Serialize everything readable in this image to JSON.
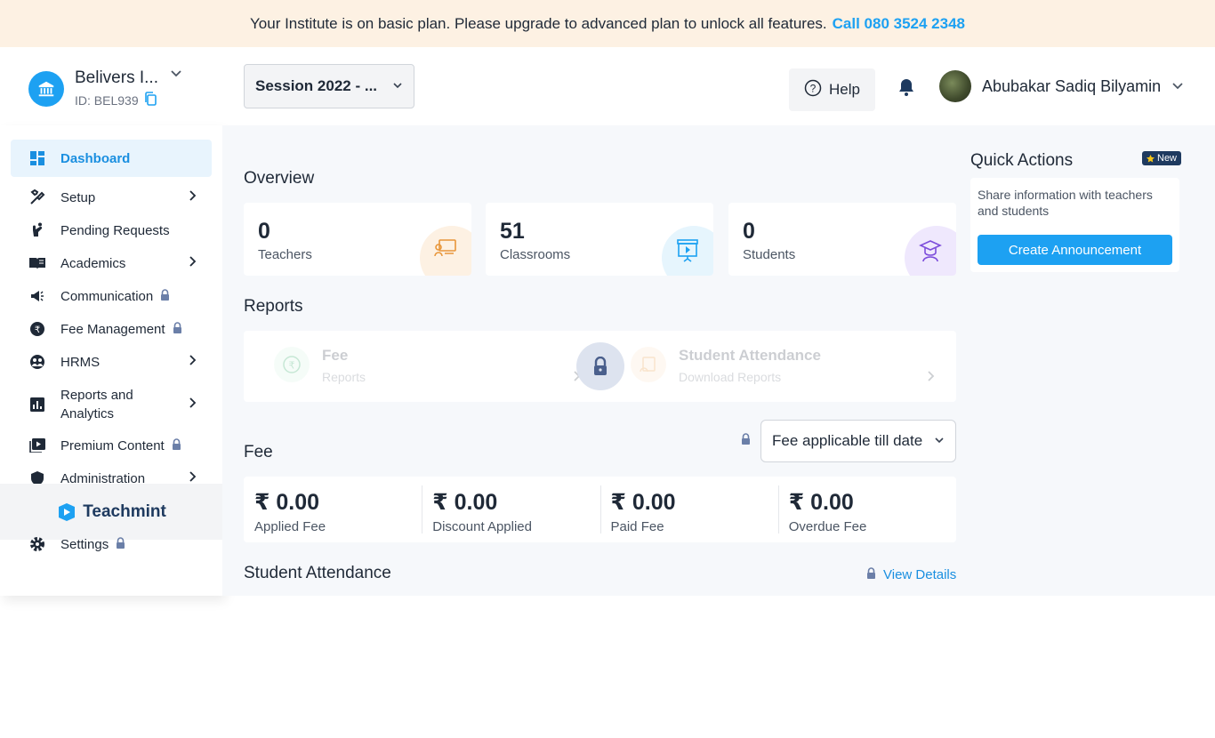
{
  "banner": {
    "text": "Your Institute is on basic plan. Please upgrade to advanced plan to unlock all features.",
    "cta": "Call 080 3524 2348"
  },
  "institute": {
    "name": "Belivers I...",
    "id": "ID: BEL939"
  },
  "session": {
    "label": "Session 2022 - ..."
  },
  "header": {
    "help": "Help",
    "user_name": "Abubakar Sadiq Bilyamin"
  },
  "sidebar": {
    "items": [
      {
        "label": "Dashboard",
        "icon": "dashboard-icon",
        "active": true
      },
      {
        "label": "Setup",
        "icon": "tools-icon",
        "chevron": true
      },
      {
        "label": "Pending Requests",
        "icon": "hand-icon"
      },
      {
        "label": "Academics",
        "icon": "book-icon",
        "chevron": true
      },
      {
        "label": "Communication",
        "icon": "megaphone-icon",
        "locked": true
      },
      {
        "label": "Fee Management",
        "icon": "rupee-icon",
        "locked": true
      },
      {
        "label": "HRMS",
        "icon": "people-icon",
        "chevron": true
      },
      {
        "label": "Reports and Analytics",
        "icon": "chart-icon",
        "chevron": true
      },
      {
        "label": "Premium Content",
        "icon": "play-icon",
        "locked": true
      },
      {
        "label": "Administration",
        "icon": "shield-icon",
        "chevron": true
      },
      {
        "label": "Settings",
        "icon": "gear-icon",
        "locked": true
      }
    ],
    "brand": "Teachmint"
  },
  "overview": {
    "title": "Overview",
    "cards": [
      {
        "value": "0",
        "label": "Teachers",
        "color": "#fdf1e3"
      },
      {
        "value": "51",
        "label": "Classrooms",
        "color": "#e6f5fd"
      },
      {
        "value": "0",
        "label": "Students",
        "color": "#efe8fd"
      }
    ]
  },
  "reports": {
    "title": "Reports",
    "items": [
      {
        "title": "Fee",
        "sub": "Reports"
      },
      {
        "title": "Student Attendance",
        "sub": "Download Reports"
      }
    ]
  },
  "fee": {
    "title": "Fee",
    "filter": "Fee applicable till date",
    "cells": [
      {
        "value": "₹ 0.00",
        "label": "Applied Fee"
      },
      {
        "value": "₹ 0.00",
        "label": "Discount Applied"
      },
      {
        "value": "₹ 0.00",
        "label": "Paid Fee"
      },
      {
        "value": "₹ 0.00",
        "label": "Overdue Fee"
      }
    ]
  },
  "attendance": {
    "title": "Student Attendance",
    "view_details": "View Details"
  },
  "quick_actions": {
    "title": "Quick Actions",
    "badge": "New",
    "description": "Share information with teachers and students",
    "button": "Create Announcement"
  },
  "colors": {
    "accent": "#1da1f2",
    "active_bg": "#e8f4fd",
    "lock": "#6b7fa8"
  }
}
